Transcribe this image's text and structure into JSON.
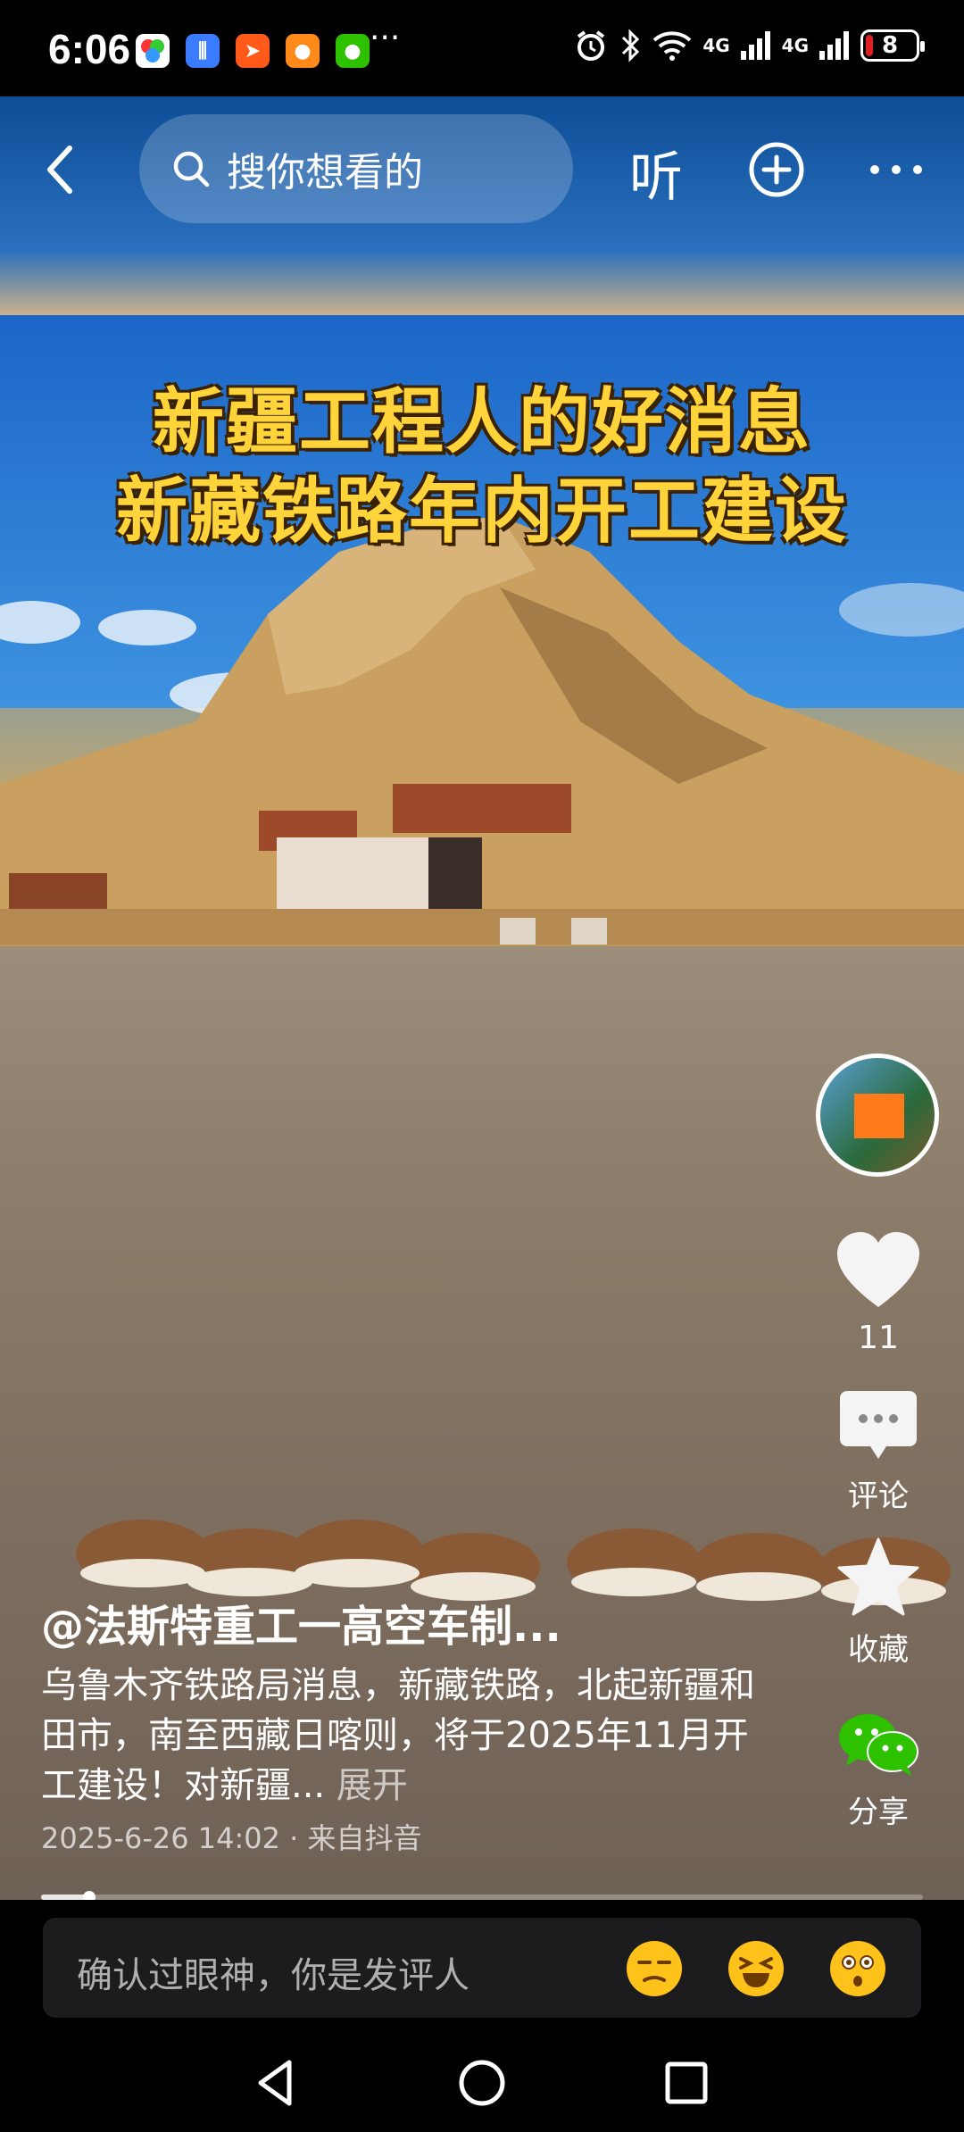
{
  "status_bar": {
    "time": "6:06",
    "more_dots": "···",
    "signal1": "4G",
    "signal2": "4G",
    "battery": "8"
  },
  "top_bar": {
    "search_placeholder": "搜你想看的",
    "listen_label": "听"
  },
  "video": {
    "banner_line1": "新疆工程人的好消息",
    "banner_line2": "新藏铁路年内开工建设"
  },
  "actions": {
    "like_count": "11",
    "comment_label": "评论",
    "favorite_label": "收藏",
    "share_label": "分享"
  },
  "caption": {
    "author": "@法斯特重工一高空车制...",
    "description": "乌鲁木齐铁路局消息，新藏铁路，北起新疆和田市，南至西藏日喀则，将于2025年11月开工建设！对新疆...",
    "expand": "展开",
    "date": "2025-6-26 14:02",
    "source": "来自抖音"
  },
  "progress": {
    "played_fraction": 0.055
  },
  "comment_bar": {
    "placeholder": "确认过眼神，你是发评人"
  },
  "colors": {
    "accent_yellow": "#ffd43a",
    "wechat_green": "#2dc100",
    "emoji_yellow": "#ffc21a"
  },
  "icons": [
    "back-icon",
    "search-icon",
    "plus-icon",
    "more-icon",
    "heart-icon",
    "comment-icon",
    "star-icon",
    "wechat-icon",
    "triangle-back-icon",
    "circle-home-icon",
    "square-recents-icon"
  ]
}
